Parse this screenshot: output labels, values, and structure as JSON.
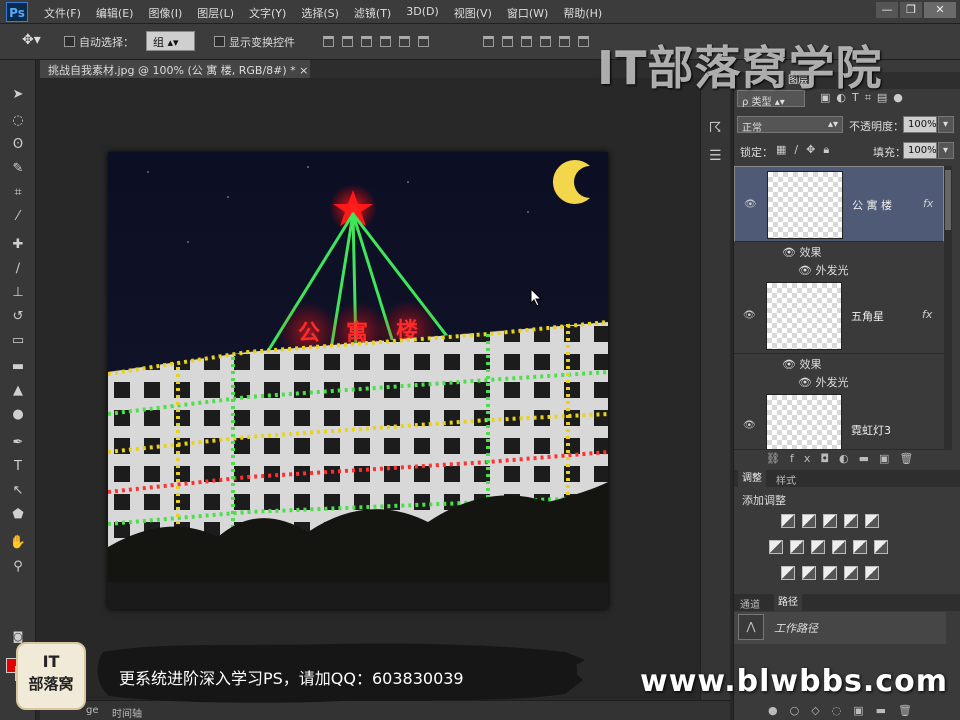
{
  "app": {
    "logo": "Ps"
  },
  "menu": [
    "文件(F)",
    "编辑(E)",
    "图像(I)",
    "图层(L)",
    "文字(Y)",
    "选择(S)",
    "滤镜(T)",
    "3D(D)",
    "视图(V)",
    "窗口(W)",
    "帮助(H)"
  ],
  "window_buttons": {
    "minimize": "—",
    "restore": "❐",
    "close": "✕"
  },
  "options": {
    "auto_select_label": "自动选择：",
    "auto_select_value": "组",
    "show_transform_label": "显示变换控件"
  },
  "document_tab": {
    "title": "挑战自我素材.jpg @ 100% (公 寓 楼, RGB/8#) *",
    "close": "×"
  },
  "watermark": "IT部落窝学院",
  "layers_panel": {
    "tab_partial": "图层",
    "filter_kind": "ρ 类型",
    "blend_mode": "正常",
    "opacity_label": "不透明度：",
    "opacity_value": "100%",
    "lock_label": "锁定：",
    "fill_label": "填充：",
    "fill_value": "100%",
    "layers": [
      {
        "name": "公 寓 楼",
        "fx": "fx",
        "effects_label": "效果",
        "effect": "外发光"
      },
      {
        "name": "五角星",
        "fx": "fx",
        "effects_label": "效果",
        "effect": "外发光"
      },
      {
        "name": "霓虹灯3",
        "fx": "",
        "effects_label": "",
        "effect": ""
      }
    ]
  },
  "adjustments_panel": {
    "tab1": "调整",
    "tab2": "样式",
    "title": "添加调整"
  },
  "paths_panel": {
    "tab1": "通道",
    "tab2": "路径",
    "path_name": "工作路径"
  },
  "banner": {
    "text": "更系统进阶深入学习PS，请加QQ：603830039"
  },
  "logo_badge": {
    "line1": "IT",
    "line2": "部落窝"
  },
  "site_url": "www.blwbbs.com",
  "bottom": {
    "timeline": "时间轴",
    "tab_fragment": "ge"
  },
  "canvas_sign": [
    "公",
    "寓",
    "楼"
  ],
  "colors": {
    "fg": "#e20000",
    "bg": "#00c800",
    "selected_layer": "#4f5b76"
  }
}
